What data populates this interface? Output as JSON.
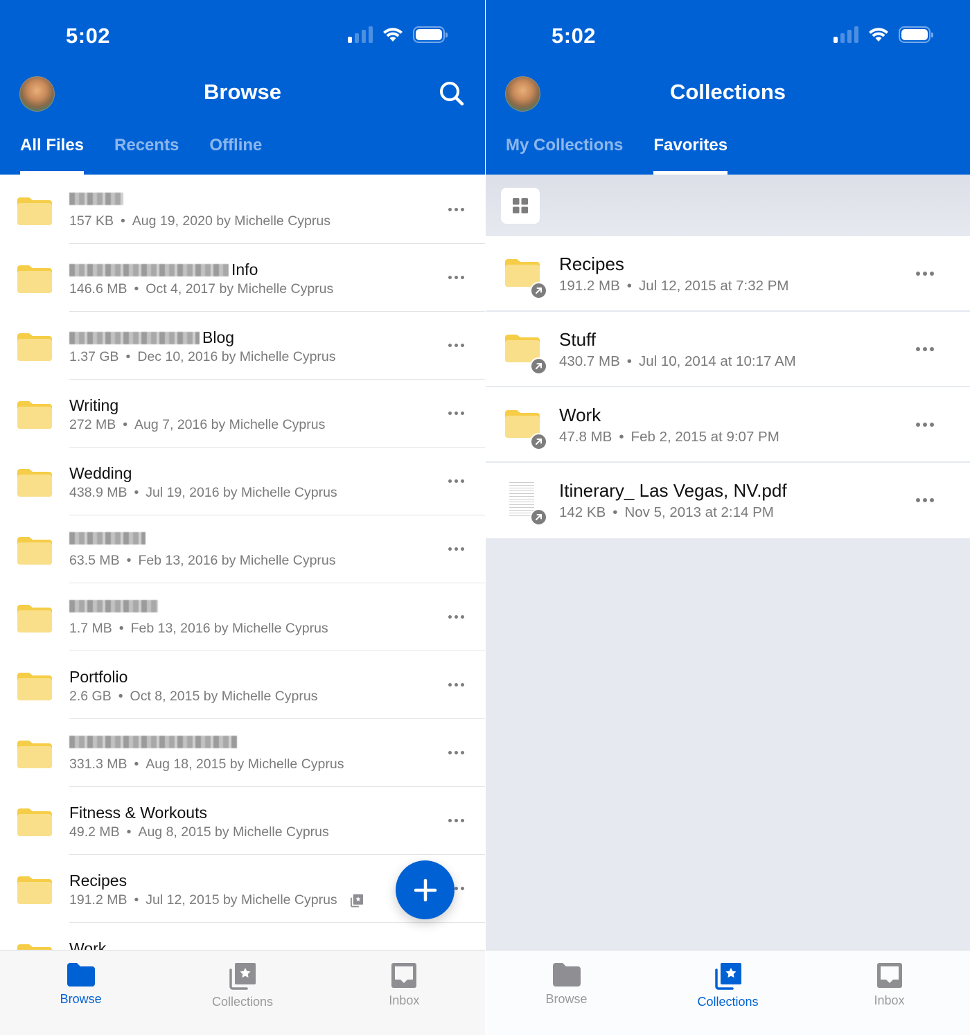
{
  "left": {
    "status": {
      "time": "5:02"
    },
    "header": {
      "title": "Browse"
    },
    "tabs": [
      {
        "label": "All Files",
        "active": true
      },
      {
        "label": "Recents",
        "active": false
      },
      {
        "label": "Offline",
        "active": false
      }
    ],
    "files": [
      {
        "name_visible": "",
        "name_redacted": true,
        "redacted_width": 78,
        "size": "157 KB",
        "date": "Aug 19, 2020 by Michelle Cyprus"
      },
      {
        "name_visible": "Info",
        "name_redacted": true,
        "redacted_width": 230,
        "size": "146.6 MB",
        "date": "Oct 4, 2017 by Michelle Cyprus"
      },
      {
        "name_visible": "Blog",
        "name_redacted": true,
        "redacted_width": 188,
        "size": "1.37 GB",
        "date": "Dec 10, 2016 by Michelle Cyprus"
      },
      {
        "name_visible": "Writing",
        "name_redacted": false,
        "size": "272 MB",
        "date": "Aug 7, 2016 by Michelle Cyprus"
      },
      {
        "name_visible": "Wedding",
        "name_redacted": false,
        "size": "438.9 MB",
        "date": "Jul 19, 2016 by Michelle Cyprus"
      },
      {
        "name_visible": "",
        "name_redacted": true,
        "redacted_width": 110,
        "size": "63.5 MB",
        "date": "Feb 13, 2016 by Michelle Cyprus"
      },
      {
        "name_visible": "",
        "name_redacted": true,
        "redacted_width": 128,
        "size": "1.7 MB",
        "date": "Feb 13, 2016 by Michelle Cyprus"
      },
      {
        "name_visible": "Portfolio",
        "name_redacted": false,
        "size": "2.6 GB",
        "date": "Oct 8, 2015 by Michelle Cyprus"
      },
      {
        "name_visible": "",
        "name_redacted": true,
        "redacted_width": 242,
        "size": "331.3 MB",
        "date": "Aug 18, 2015 by Michelle Cyprus"
      },
      {
        "name_visible": "Fitness & Workouts",
        "name_redacted": false,
        "size": "49.2 MB",
        "date": "Aug 8, 2015 by Michelle Cyprus"
      },
      {
        "name_visible": "Recipes",
        "name_redacted": false,
        "size": "191.2 MB",
        "date": "Jul 12, 2015 by Michelle Cyprus",
        "in_collection": true
      },
      {
        "name_visible": "Work",
        "name_redacted": false,
        "size": "",
        "date": ""
      }
    ],
    "fab": {
      "icon": "plus-icon"
    },
    "tabbar": [
      {
        "label": "Browse",
        "icon": "folder-icon",
        "active": true
      },
      {
        "label": "Collections",
        "icon": "collections-star-icon",
        "active": false
      },
      {
        "label": "Inbox",
        "icon": "inbox-icon",
        "active": false
      }
    ]
  },
  "right": {
    "status": {
      "time": "5:02"
    },
    "header": {
      "title": "Collections"
    },
    "tabs": [
      {
        "label": "My Collections",
        "active": false
      },
      {
        "label": "Favorites",
        "active": true
      }
    ],
    "view_toggle": {
      "icon": "grid-view-icon"
    },
    "favorites": [
      {
        "name": "Recipes",
        "type": "folder",
        "size": "191.2 MB",
        "date": "Jul 12, 2015 at 7:32 PM"
      },
      {
        "name": "Stuff",
        "type": "folder",
        "size": "430.7 MB",
        "date": "Jul 10, 2014 at 10:17 AM"
      },
      {
        "name": "Work",
        "type": "folder",
        "size": "47.8 MB",
        "date": "Feb 2, 2015 at 9:07 PM"
      },
      {
        "name": "Itinerary_ Las Vegas, NV.pdf",
        "type": "pdf",
        "size": "142 KB",
        "date": "Nov 5, 2013 at 2:14 PM"
      }
    ],
    "tabbar": [
      {
        "label": "Browse",
        "icon": "folder-icon",
        "active": false
      },
      {
        "label": "Collections",
        "icon": "collections-star-icon",
        "active": true
      },
      {
        "label": "Inbox",
        "icon": "inbox-icon",
        "active": false
      }
    ]
  },
  "colors": {
    "brand_blue": "#0061d5",
    "folder_yellow": "#f9df8a",
    "folder_tab": "#f5cd47",
    "meta_gray": "#7b7b7b",
    "inactive_icon": "#8e8e93"
  }
}
